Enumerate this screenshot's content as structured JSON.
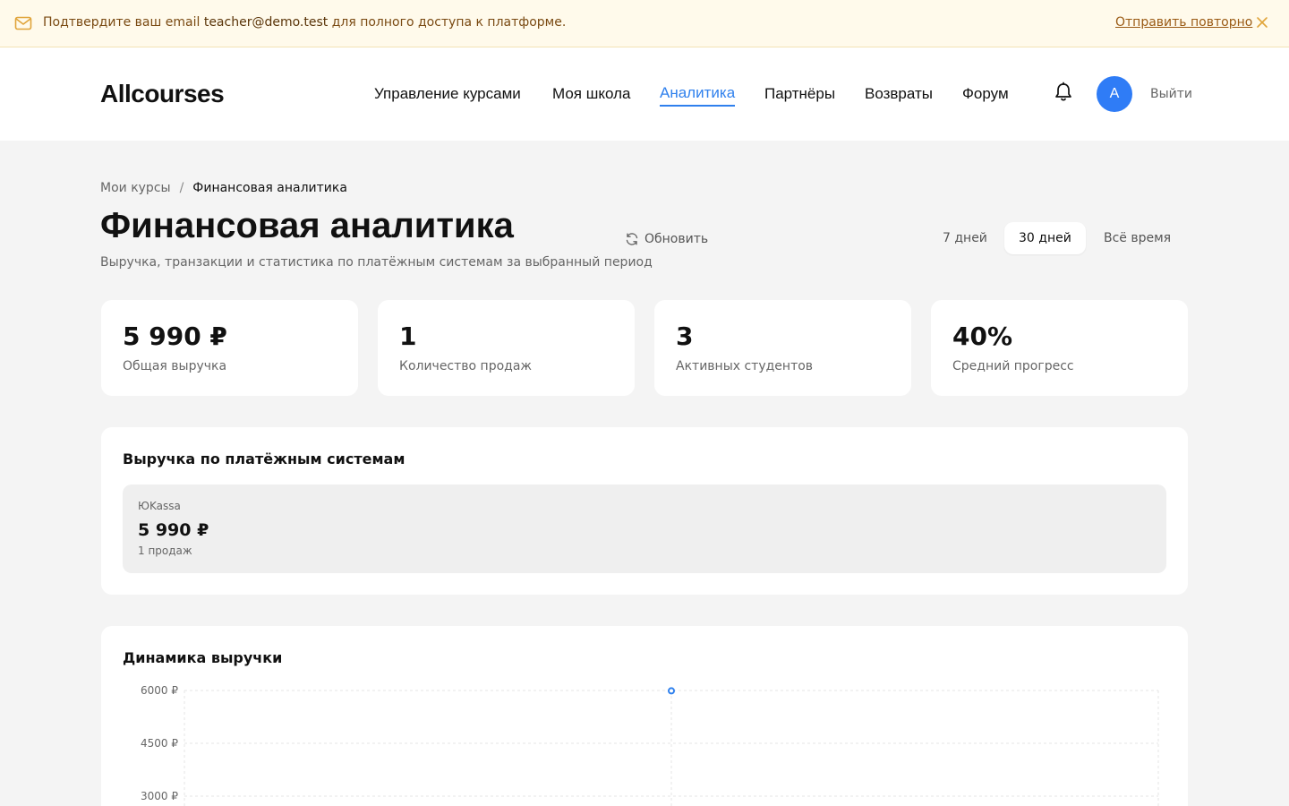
{
  "banner": {
    "message_before": "Подтвердите ваш email ",
    "email": "teacher@demo.test",
    "message_after": " для полного доступа к платформе.",
    "resend_label": "Отправить повторно",
    "mail_icon": "mail-icon",
    "close_icon": "close-icon"
  },
  "header": {
    "logo": "Allcourses",
    "nav": [
      {
        "label": "Управление курсами",
        "active": false
      },
      {
        "label": "Моя школа",
        "active": false
      },
      {
        "label": "Аналитика",
        "active": true
      },
      {
        "label": "Партнёры",
        "active": false
      },
      {
        "label": "Возвраты",
        "active": false
      },
      {
        "label": "Форум",
        "active": false
      }
    ],
    "bell_icon": "bell-icon",
    "avatar_letter": "A",
    "logout_label": "Выйти"
  },
  "breadcrumb": {
    "link": "Мои курсы",
    "separator": "/",
    "current": "Финансовая аналитика"
  },
  "page": {
    "title": "Финансовая аналитика",
    "subtitle": "Выручка, транзакции и статистика по платёжным системам за выбранный период",
    "refresh_label": "Обновить",
    "refresh_icon": "refresh-icon",
    "periods": [
      {
        "label": "7 дней",
        "selected": false
      },
      {
        "label": "30 дней",
        "selected": true
      },
      {
        "label": "Всё время",
        "selected": false
      }
    ]
  },
  "stats": [
    {
      "value": "5 990 ₽",
      "label": "Общая выручка"
    },
    {
      "value": "1",
      "label": "Количество продаж"
    },
    {
      "value": "3",
      "label": "Активных студентов"
    },
    {
      "value": "40%",
      "label": "Средний прогресс"
    }
  ],
  "payment_systems": {
    "title": "Выручка по платёжным системам",
    "items": [
      {
        "name": "ЮKassa",
        "amount": "5 990 ₽",
        "count": "1 продаж"
      }
    ]
  },
  "revenue_chart": {
    "title": "Динамика выручки"
  },
  "colors": {
    "accent": "#2f80ed",
    "avatar": "#2f7cf6",
    "banner_bg": "#fffaeb",
    "banner_text": "#7a4a12"
  },
  "chart_data": {
    "type": "line",
    "title": "Динамика выручки",
    "ytick_labels": [
      "6000 ₽",
      "4500 ₽",
      "3000 ₽"
    ],
    "yticks": [
      6000,
      4500,
      3000
    ],
    "ylim": [
      0,
      6000
    ],
    "grid": true,
    "series": [
      {
        "points": [
          {
            "x": "middle",
            "y": 5990
          }
        ]
      }
    ],
    "point_color": "#2f80ed"
  }
}
